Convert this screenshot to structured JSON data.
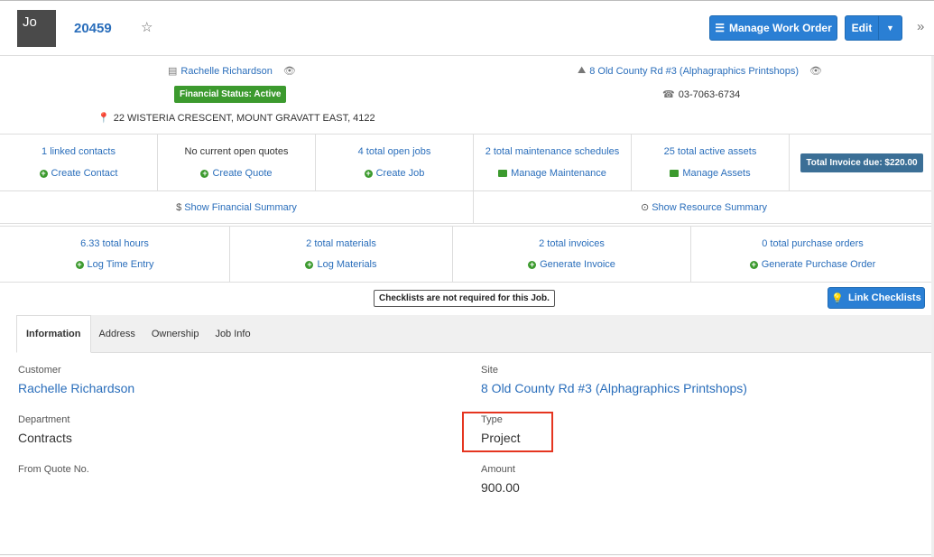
{
  "header": {
    "avatar_text": "Jo",
    "job_number": "20459",
    "manage_label": "Manage Work Order",
    "edit_label": "Edit"
  },
  "summary": {
    "customer_name": "Rachelle Richardson",
    "financial_status": "Financial Status: Active",
    "address": "22 WISTERIA CRESCENT, MOUNT GRAVATT EAST, 4122",
    "site_name": "8 Old County Rd #3 (Alphagraphics Printshops)",
    "phone": "03-7063-6734"
  },
  "stats_row1": [
    {
      "top": "1 linked contacts",
      "top_link": true,
      "action": "Create Contact",
      "icon": "plus-circle-icon"
    },
    {
      "top": "No current open quotes",
      "top_link": false,
      "action": "Create Quote",
      "icon": "plus-circle-icon"
    },
    {
      "top": "4 total open jobs",
      "top_link": true,
      "action": "Create Job",
      "icon": "plus-circle-icon"
    },
    {
      "top": "2 total maintenance schedules",
      "top_link": true,
      "action": "Manage Maintenance",
      "icon": "briefcase-icon"
    },
    {
      "top": "25 total active assets",
      "top_link": true,
      "action": "Manage Assets",
      "icon": "briefcase-icon"
    }
  ],
  "invoice_due": "Total Invoice due: $220.00",
  "financial_summary": "Show Financial Summary",
  "resource_summary": "Show Resource Summary",
  "stats_row2": [
    {
      "top": "6.33 total hours",
      "action": "Log Time Entry"
    },
    {
      "top": "2 total materials",
      "action": "Log Materials"
    },
    {
      "top": "2 total invoices",
      "action": "Generate Invoice"
    },
    {
      "top": "0 total purchase orders",
      "action": "Generate Purchase Order"
    }
  ],
  "checklist_notice": "Checklists are not required for this Job.",
  "link_checklists": "Link Checklists",
  "tabs": [
    "Information",
    "Address",
    "Ownership",
    "Job Info"
  ],
  "info": {
    "customer_label": "Customer",
    "customer_value": "Rachelle Richardson",
    "site_label": "Site",
    "site_value": "8 Old County Rd #3 (Alphagraphics Printshops)",
    "department_label": "Department",
    "department_value": "Contracts",
    "type_label": "Type",
    "type_value": "Project",
    "quote_label": "From Quote No.",
    "amount_label": "Amount",
    "amount_value": "900.00"
  },
  "colors": {
    "link": "#2a6ebb",
    "primary_button": "#2a7fd4",
    "success": "#3c9a2e",
    "invoice_badge": "#3b6f96",
    "highlight": "#e53520"
  }
}
